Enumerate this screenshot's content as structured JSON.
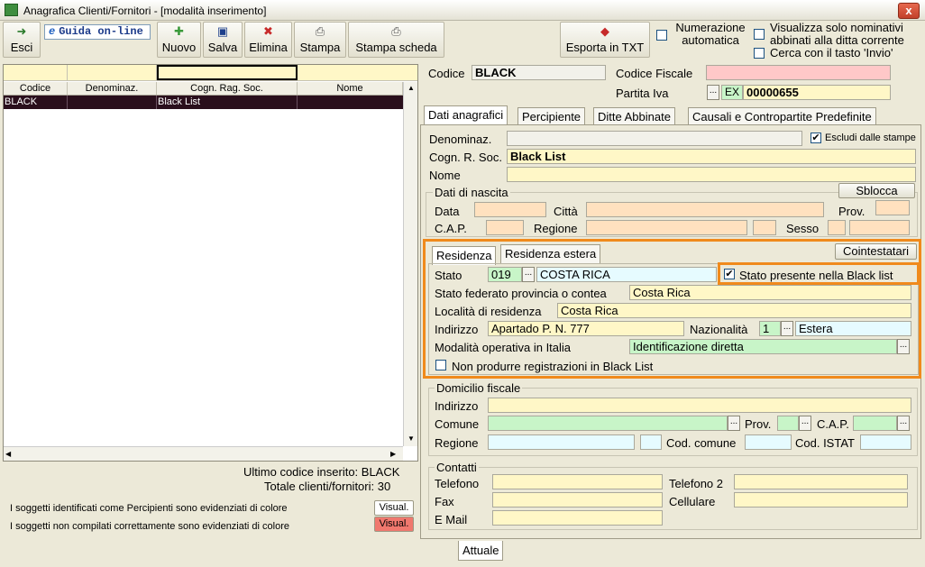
{
  "window": {
    "title": "Anagrafica Clienti/Fornitori - [modalità inserimento]",
    "close": "x"
  },
  "toolbar": {
    "esci": "Esci",
    "guida": "Guida on-line",
    "nuovo": "Nuovo",
    "salva": "Salva",
    "elimina": "Elimina",
    "stampa": "Stampa",
    "stampa_scheda": "Stampa scheda",
    "esporta": "Esporta in TXT",
    "numerazione": "Numerazione automatica",
    "visualizza": "Visualizza solo nominativi abbinati alla ditta corrente",
    "cerca": "Cerca con il tasto 'Invio'"
  },
  "grid": {
    "columns": [
      "Codice",
      "Denominaz.",
      "Cogn. Rag. Soc.",
      "Nome"
    ],
    "rows": [
      {
        "codice": "BLACK",
        "denominaz": "",
        "cogn": "Black List",
        "nome": ""
      }
    ]
  },
  "footer": {
    "ultimo": "Ultimo codice inserito: BLACK",
    "totale": "Totale clienti/fornitori: 30",
    "percipienti_note": "I soggetti identificati come Percipienti sono evidenziati di colore",
    "non_compilati_note": "I soggetti non compilati correttamente sono evidenziati di colore",
    "visual": "Visual."
  },
  "header": {
    "codice_label": "Codice",
    "codice": "BLACK",
    "cf_label": "Codice Fiscale",
    "cf": "",
    "piva_label": "Partita Iva",
    "piva_prefix": "EX",
    "piva": "00000655"
  },
  "tabs": [
    "Dati anagrafici",
    "Percipiente",
    "Ditte Abbinate",
    "Causali e Contropartite Predefinite"
  ],
  "anag": {
    "denominaz_label": "Denominaz.",
    "denominaz": "",
    "escludi": "Escludi dalle stampe",
    "cogn_label": "Cogn. R. Soc.",
    "cogn": "Black List",
    "nome_label": "Nome",
    "nome": ""
  },
  "nascita": {
    "title": "Dati di nascita",
    "sblocca": "Sblocca",
    "data": "Data",
    "citta": "Città",
    "prov": "Prov.",
    "cap": "C.A.P.",
    "regione": "Regione",
    "sesso": "Sesso"
  },
  "residenza": {
    "tabs": [
      "Residenza",
      "Residenza estera"
    ],
    "cointestatari": "Cointestatari",
    "stato_label": "Stato",
    "stato_code": "019",
    "stato": "COSTA RICA",
    "black_list": "Stato presente nella Black list",
    "federato_label": "Stato federato provincia o contea",
    "federato": "Costa Rica",
    "localita_label": "Località di residenza",
    "localita": "Costa Rica",
    "indirizzo_label": "Indirizzo",
    "indirizzo": "Apartado P. N.  777",
    "naz_label": "Nazionalità",
    "naz_code": "1",
    "naz": "Estera",
    "modalita_label": "Modalità operativa in Italia",
    "modalita": "Identificazione diretta",
    "non_produrre": "Non produrre registrazioni in Black List"
  },
  "domicilio": {
    "title": "Domicilio fiscale",
    "indirizzo": "Indirizzo",
    "comune": "Comune",
    "prov": "Prov.",
    "cap": "C.A.P.",
    "regione": "Regione",
    "cod_comune": "Cod. comune",
    "cod_istat": "Cod. ISTAT"
  },
  "contatti": {
    "title": "Contatti",
    "telefono": "Telefono",
    "telefono2": "Telefono 2",
    "fax": "Fax",
    "cellulare": "Cellulare",
    "email": "E Mail"
  },
  "bottom_tab": "Attuale",
  "colors": {
    "highlight": "#f08a1c",
    "percipienti": "#ffffff",
    "non_compilati": "#f0786e"
  }
}
